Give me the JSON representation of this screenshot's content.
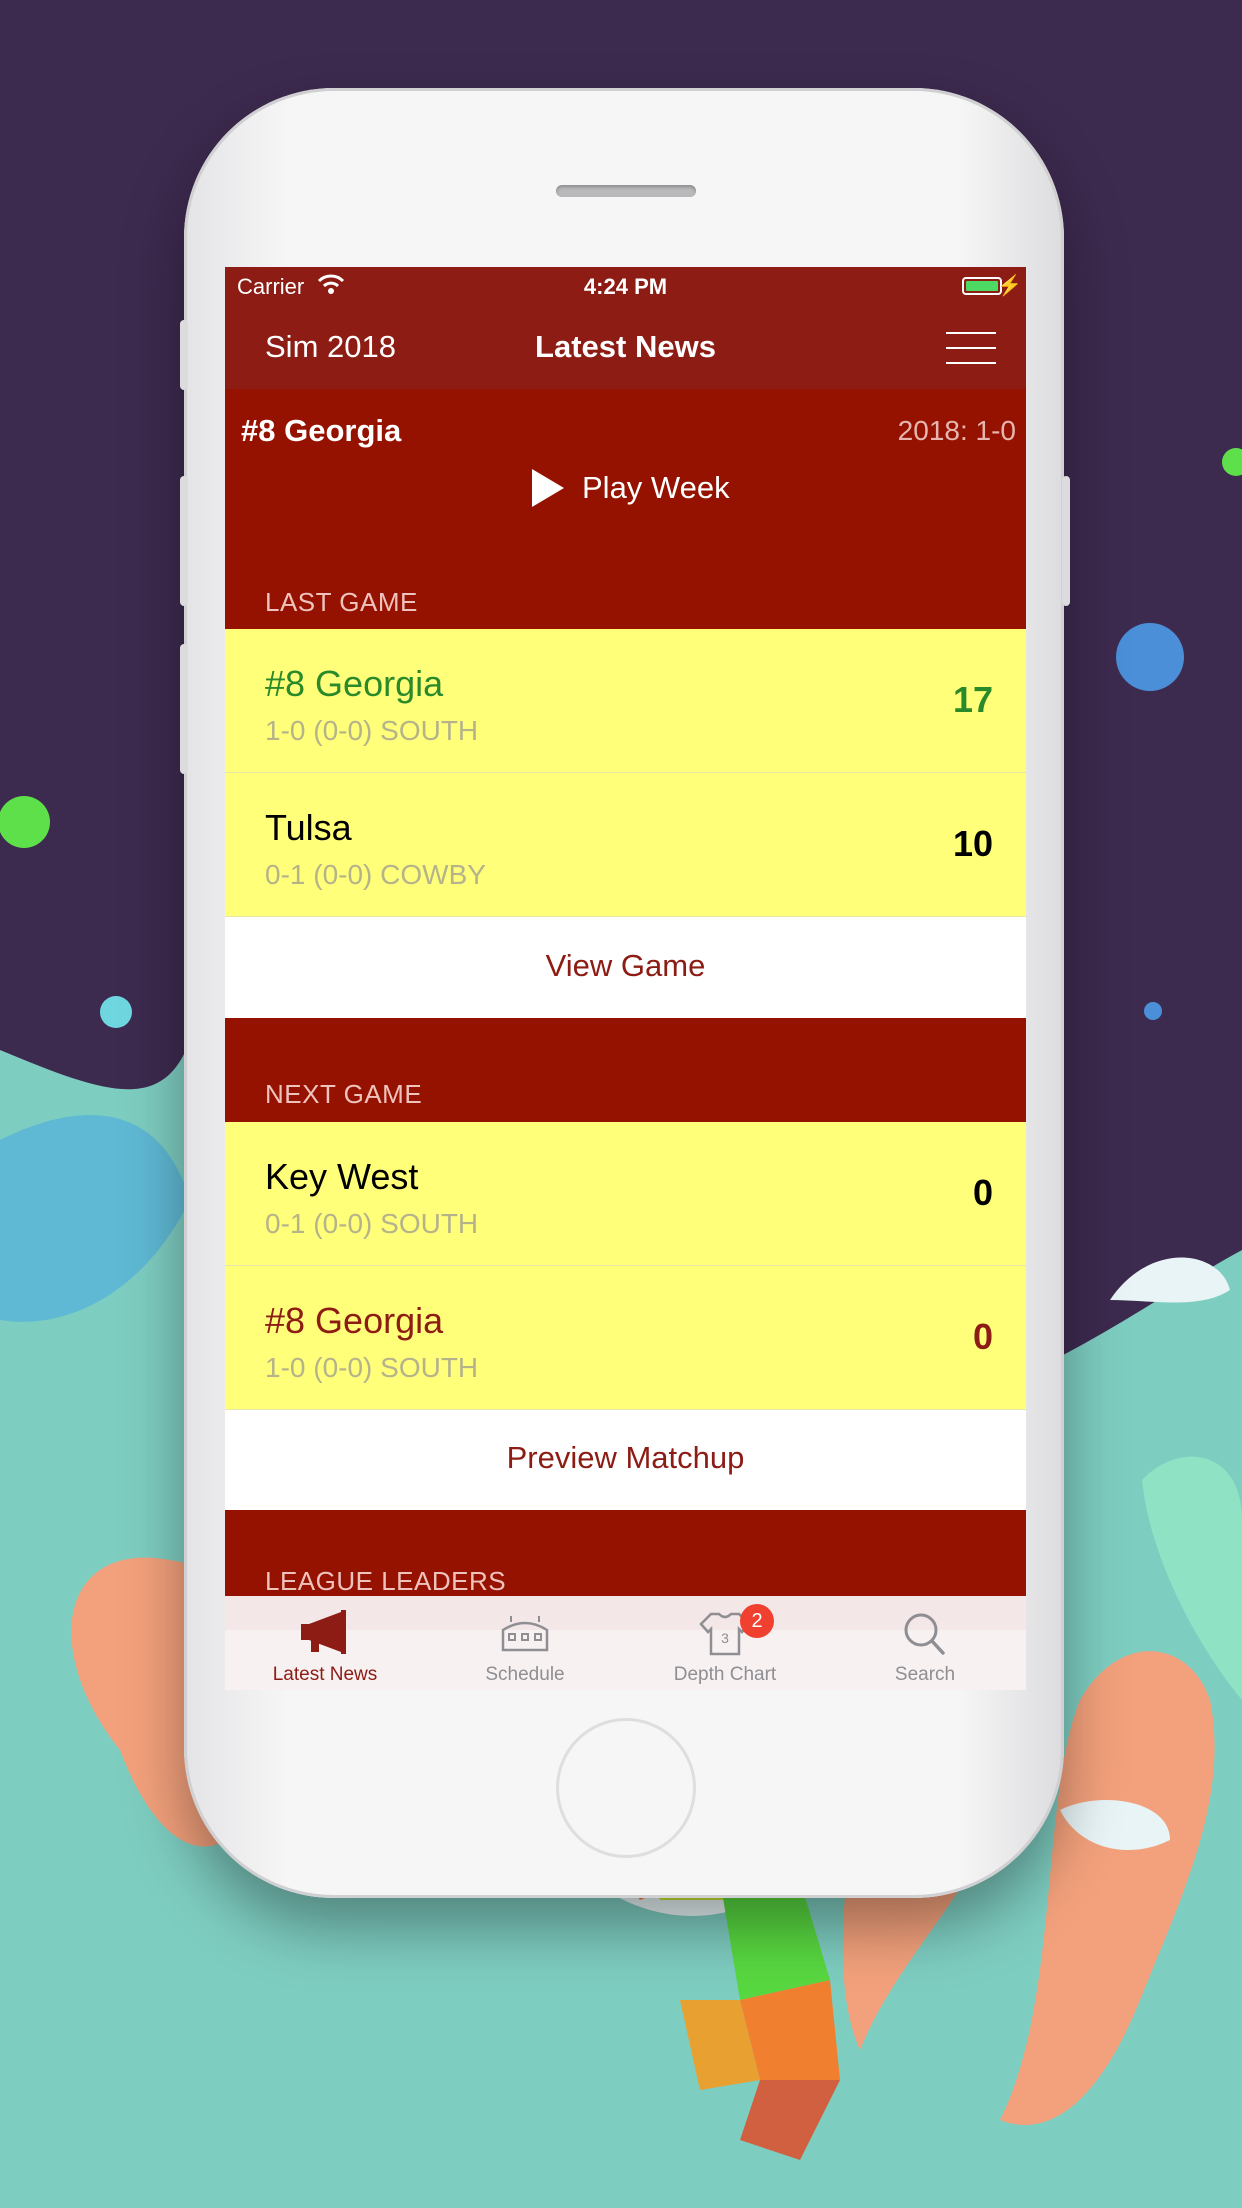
{
  "status_bar": {
    "carrier": "Carrier",
    "time": "4:24 PM"
  },
  "nav": {
    "left_label": "Sim 2018",
    "title": "Latest News",
    "menu_icon": "hamburger-menu-icon"
  },
  "header": {
    "team": "#8 Georgia",
    "record": "2018: 1-0",
    "play_button": "Play Week"
  },
  "last_game": {
    "section_label": "LAST GAME",
    "teams": [
      {
        "name": "#8 Georgia",
        "meta": "1-0 (0-0) SOUTH",
        "score": "17",
        "color": "#2a8a2a"
      },
      {
        "name": "Tulsa",
        "meta": "0-1 (0-0) COWBY",
        "score": "10",
        "color": "#000000"
      }
    ],
    "action_label": "View Game"
  },
  "next_game": {
    "section_label": "NEXT GAME",
    "teams": [
      {
        "name": "Key West",
        "meta": "0-1 (0-0) SOUTH",
        "score": "0",
        "color": "#000000"
      },
      {
        "name": "#8 Georgia",
        "meta": "1-0 (0-0) SOUTH",
        "score": "0",
        "color": "#8c1c14"
      }
    ],
    "action_label": "Preview Matchup"
  },
  "league_leaders": {
    "section_label": "LEAGUE LEADERS"
  },
  "tabbar": {
    "items": [
      {
        "label": "Latest News",
        "icon": "megaphone-icon",
        "active": true
      },
      {
        "label": "Schedule",
        "icon": "stadium-icon",
        "active": false
      },
      {
        "label": "Depth Chart",
        "icon": "jersey-icon",
        "active": false,
        "badge": "2"
      },
      {
        "label": "Search",
        "icon": "search-icon",
        "active": false
      }
    ]
  },
  "colors": {
    "nav_red": "#8c1c14",
    "section_red": "#961200",
    "row_yellow": "#ffff7a",
    "background_purple": "#3d2a4f",
    "background_teal": "#7ecdc1"
  }
}
